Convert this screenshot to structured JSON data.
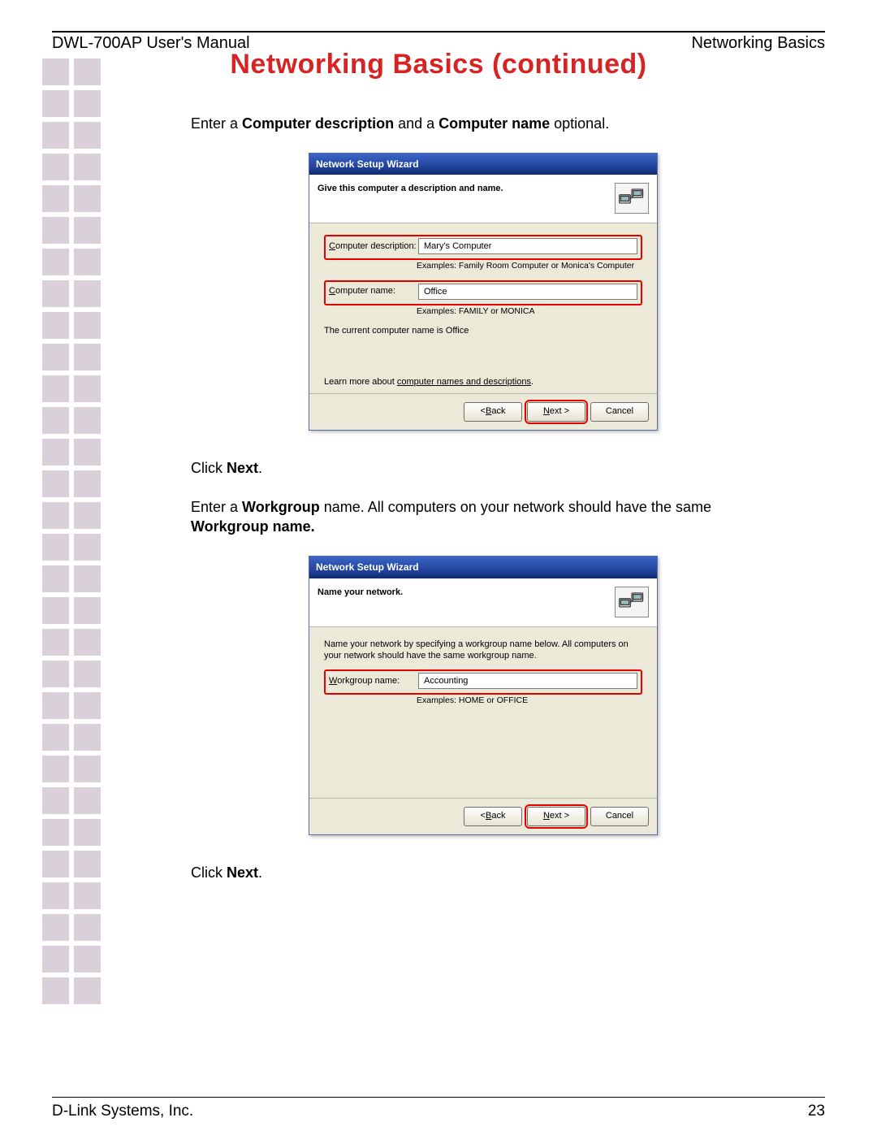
{
  "header": {
    "left": "DWL-700AP User's Manual",
    "right": "Networking Basics"
  },
  "title": "Networking Basics (continued)",
  "intro1_pre": "Enter a ",
  "intro1_b1": "Computer description",
  "intro1_mid": " and a ",
  "intro1_b2": "Computer name",
  "intro1_post": " optional.",
  "wizard1": {
    "title": "Network Setup Wizard",
    "subtitle": "Give this computer a description and name.",
    "desc_label_ul": "C",
    "desc_label": "omputer description:",
    "desc_value": "Mary's Computer",
    "desc_examples": "Examples: Family Room Computer or Monica's Computer",
    "name_label_ul": "C",
    "name_label": "omputer name:",
    "name_value": "Office",
    "name_examples": "Examples: FAMILY or MONICA",
    "current_note": "The current computer name is Office",
    "learn_pre": "Learn more about ",
    "learn_link": "computer names and descriptions",
    "back_ul": "B",
    "back": "ack",
    "next_ul": "N",
    "next": "ext >",
    "cancel": "Cancel"
  },
  "click_next1_pre": "Click ",
  "click_next1_b": "Next",
  "click_next1_post": ".",
  "intro2_pre": "Enter a ",
  "intro2_b1": "Workgroup",
  "intro2_mid": " name. All computers on your network should have the same ",
  "intro2_b2": "Workgroup name.",
  "wizard2": {
    "title": "Network Setup Wizard",
    "subtitle": "Name your network.",
    "body_text": "Name your network by specifying a workgroup name below. All computers on your network should have the same workgroup name.",
    "wg_label_ul": "W",
    "wg_label": "orkgroup name:",
    "wg_value": "Accounting",
    "wg_examples": "Examples: HOME or OFFICE",
    "back_ul": "B",
    "back": "ack",
    "next_ul": "N",
    "next": "ext >",
    "cancel": "Cancel"
  },
  "click_next2_pre": "Click ",
  "click_next2_b": "Next",
  "click_next2_post": ".",
  "footer": {
    "left": "D-Link Systems, Inc.",
    "page": "23"
  }
}
